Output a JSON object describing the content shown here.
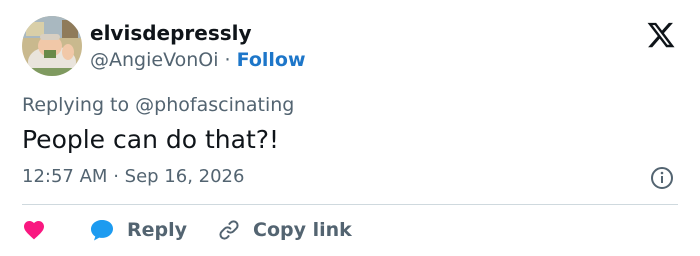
{
  "author": {
    "display_name": "elvisdepressly",
    "handle": "@AngieVonOi",
    "separator": "·",
    "follow_label": "Follow",
    "follow_color": "#1d76c9"
  },
  "brand_icon": "x-logo-icon",
  "tweet": {
    "reply_prefix": "Replying to",
    "reply_to": "@phofascinating",
    "text": "People can do that?!",
    "time": "12:57 AM",
    "date_separator": "·",
    "date": "Sep 16, 2026"
  },
  "actions": {
    "like_icon": "heart-icon",
    "like_color": "#f91880",
    "reply_icon": "speech-bubble-icon",
    "reply_label": "Reply",
    "reply_color": "#1d9bf0",
    "copy_icon": "link-icon",
    "copy_label": "Copy link"
  },
  "info_icon": "info-icon"
}
